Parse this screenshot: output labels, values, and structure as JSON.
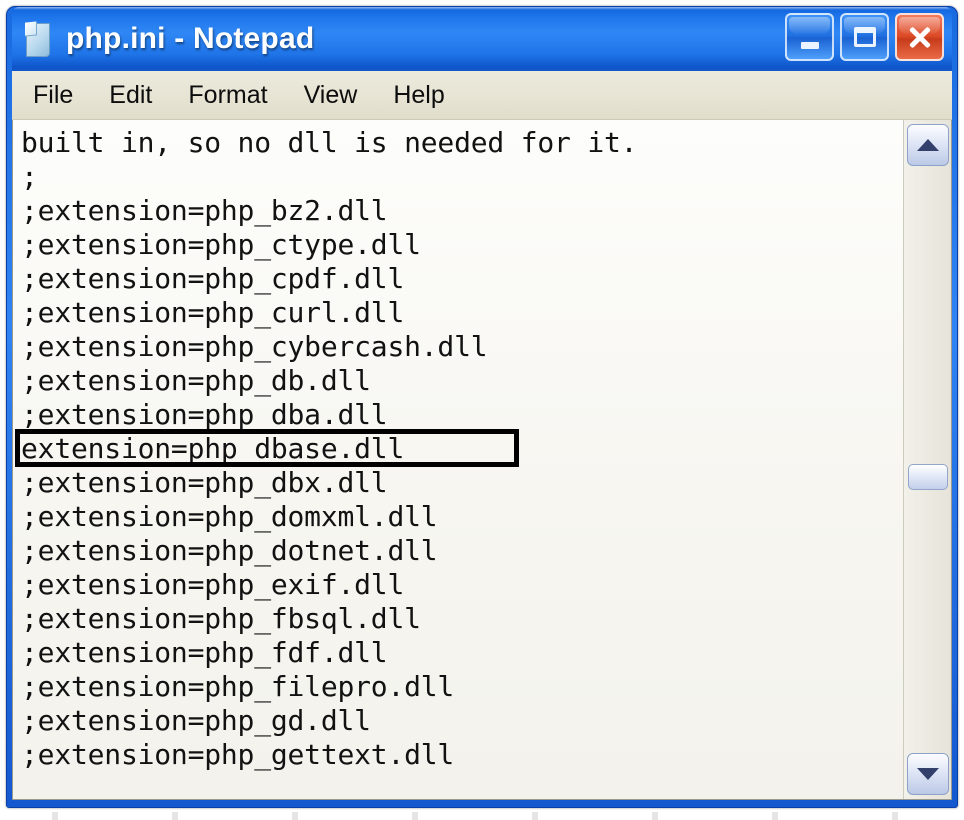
{
  "window": {
    "title": "php.ini - Notepad",
    "icon": "notepad-document-icon",
    "titlebar_color": "#1d74ea",
    "frame_color": "#0b3fa8"
  },
  "window_controls": {
    "minimize_label": "Minimize",
    "maximize_label": "Maximize",
    "close_label": "Close",
    "close_color": "#dc4a26"
  },
  "menu": {
    "items": [
      {
        "label": "File"
      },
      {
        "label": "Edit"
      },
      {
        "label": "Format"
      },
      {
        "label": "View"
      },
      {
        "label": "Help"
      }
    ]
  },
  "editor": {
    "lines": [
      "built in, so no dll is needed for it.",
      ";",
      ";extension=php_bz2.dll",
      ";extension=php_ctype.dll",
      ";extension=php_cpdf.dll",
      ";extension=php_curl.dll",
      ";extension=php_cybercash.dll",
      ";extension=php_db.dll",
      ";extension=php_dba.dll",
      "extension=php_dbase.dll",
      ";extension=php_dbx.dll",
      ";extension=php_domxml.dll",
      ";extension=php_dotnet.dll",
      ";extension=php_exif.dll",
      ";extension=php_fbsql.dll",
      ";extension=php_fdf.dll",
      ";extension=php_filepro.dll",
      ";extension=php_gd.dll",
      ";extension=php_gettext.dll"
    ],
    "highlighted_line_index": 9,
    "highlighted_line_text": "extension=php_dbase.dll",
    "highlight_color": "#000000",
    "text_color": "#121212",
    "background_color": "#fbfaf7"
  },
  "scrollbar": {
    "up_arrow": "chevron-up-icon",
    "down_arrow": "chevron-down-icon",
    "thumb_label": "scroll-thumb"
  }
}
